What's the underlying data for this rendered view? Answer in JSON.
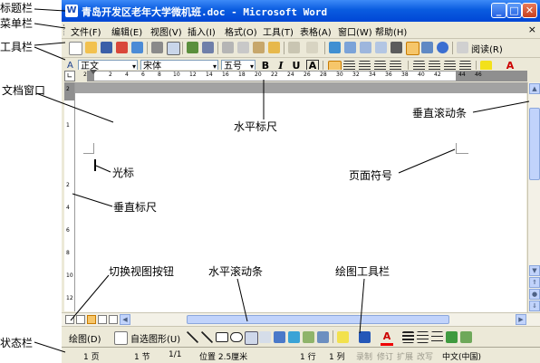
{
  "window": {
    "title": "青岛开发区老年大学微机班.doc - Microsoft Word",
    "app_icon": "W",
    "buttons": {
      "minimize": "_",
      "maximize": "□",
      "close": "✕"
    }
  },
  "menubar": {
    "items": [
      "文件(F)",
      "编辑(E)",
      "视图(V)",
      "插入(I)",
      "格式(O)",
      "工具(T)",
      "表格(A)",
      "窗口(W)",
      "帮助(H)"
    ],
    "close": "×"
  },
  "toolbar": {
    "reading_label": "阅读(R)"
  },
  "formatting": {
    "style": "正文",
    "font": "宋体",
    "size": "五号",
    "bold": "B",
    "italic": "I",
    "underline": "U",
    "char_border": "A",
    "font_color": "A"
  },
  "ruler": {
    "h_ticks": [
      "2",
      "2",
      "4",
      "6",
      "8",
      "10",
      "12",
      "14",
      "16",
      "18",
      "20",
      "22",
      "24",
      "26",
      "28",
      "30",
      "32",
      "34",
      "36",
      "38",
      "40",
      "42",
      "44",
      "46"
    ],
    "v_ticks": [
      "2",
      "1",
      "2",
      "4",
      "6",
      "8",
      "10",
      "12"
    ]
  },
  "drawing_toolbar": {
    "draw_label": "绘图(D)",
    "autoshapes_label": "自选图形(U)"
  },
  "statusbar": {
    "page": "1 页",
    "section": "1 节",
    "page_of": "1/1",
    "position": "位置 2.5厘米",
    "line": "1 行",
    "column": "1 列",
    "rec": "录制",
    "trk": "修订",
    "ext": "扩展",
    "ovr": "改写",
    "language": "中文(中国)"
  },
  "annotations": {
    "title_bar": "标题栏",
    "menu_bar": "菜单栏",
    "toolbar": "工具栏",
    "doc_window": "文档窗口",
    "h_ruler": "水平标尺",
    "v_scroll": "垂直滚动条",
    "cursor": "光标",
    "page_symbol": "页面符号",
    "v_ruler": "垂直标尺",
    "view_buttons": "切换视图按钮",
    "h_scroll": "水平滚动条",
    "drawing_toolbar": "绘图工具栏",
    "status_bar": "状态栏"
  },
  "colors": {
    "titlebar": "#0a5ce0",
    "chrome": "#ece9d8",
    "scroll": "#c1d3fb"
  }
}
